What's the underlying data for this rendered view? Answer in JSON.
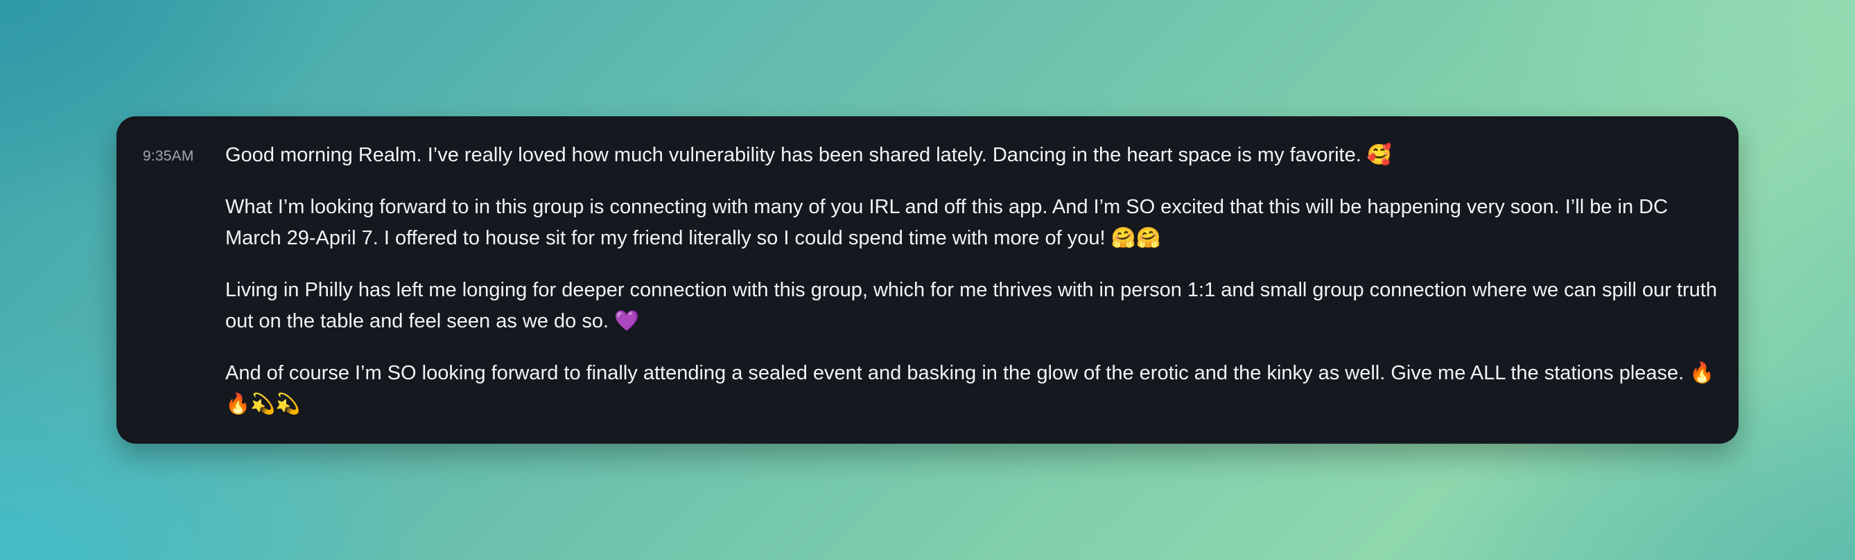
{
  "message": {
    "timestamp": "9:35AM",
    "paragraphs": [
      "Good morning Realm. I’ve really loved how much vulnerability has been shared lately. Dancing in the heart space is my favorite. 🥰",
      "What I’m looking forward to in this group is connecting with many of you IRL and off this app. And I’m SO excited that this will be happening very soon. I’ll be in DC March 29-April 7. I offered to house sit for my friend literally so I could spend time with more of you! 🤗🤗",
      "Living in Philly has left me longing for deeper connection with this group, which for me thrives with in person 1:1 and small group connection where we can spill our truth out on the table and feel seen as we do so. 💜",
      "And of course I’m SO looking forward to finally attending a sealed event and basking in the glow of the erotic and the kinky as well. Give me ALL the stations please. 🔥🔥💫💫"
    ]
  },
  "colors": {
    "card_background": "#15181f",
    "message_text": "#f3f4f6",
    "timestamp_text": "#a2a7b3",
    "page_gradient": [
      "#3aa3ad",
      "#7cccac",
      "#8fd8ae"
    ]
  }
}
